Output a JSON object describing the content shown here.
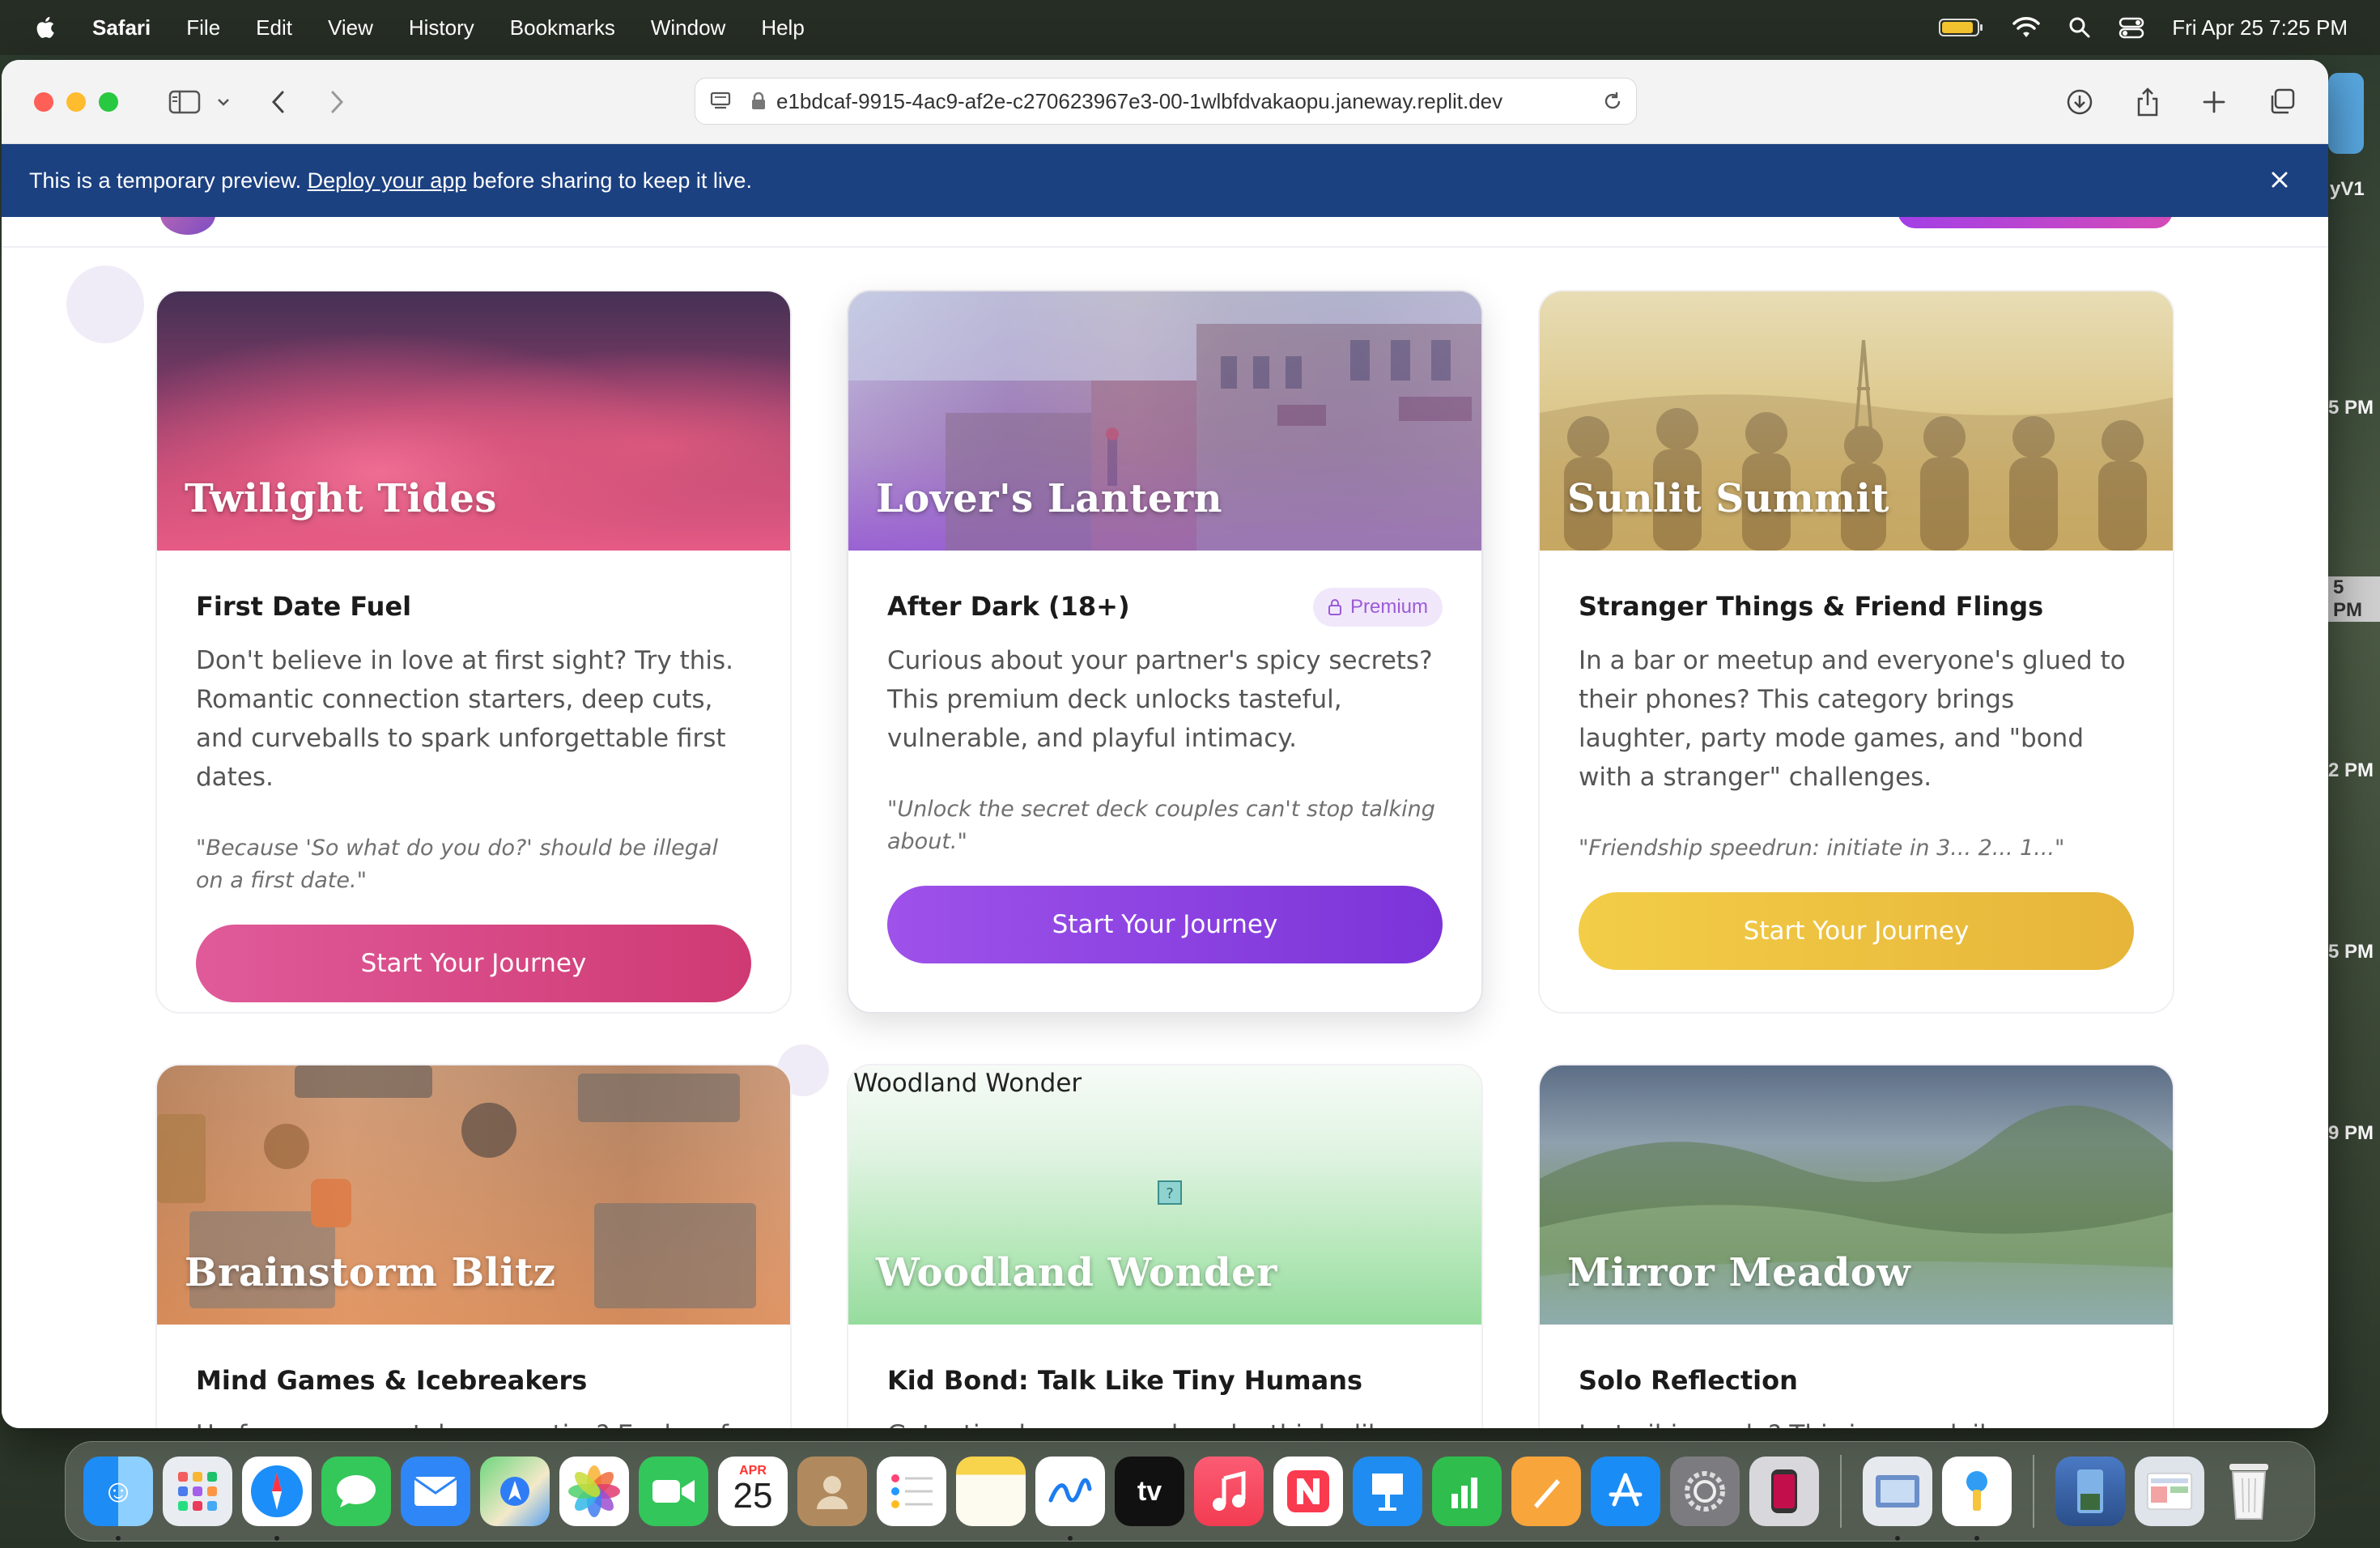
{
  "menubar": {
    "app": "Safari",
    "items": [
      "File",
      "Edit",
      "View",
      "History",
      "Bookmarks",
      "Window",
      "Help"
    ],
    "datetime": "Fri Apr 25  7:25 PM"
  },
  "browser": {
    "url": "e1bdcaf-9915-4ac9-af2e-c270623967e3-00-1wlbfdvakaopu.janeway.replit.dev"
  },
  "banner": {
    "prefix": "This is a temporary preview. ",
    "link": "Deploy your app",
    "suffix": " before sharing to keep it live."
  },
  "cards": [
    {
      "hero_title": "Twilight Tides",
      "category": "First Date Fuel",
      "description": "Don't believe in love at first sight? Try this. Romantic connection starters, deep cuts, and curveballs to spark unforgettable first dates.",
      "quote": "\"Because 'So what do you do?' should be illegal on a first date.\"",
      "button": "Start Your Journey",
      "colors": {
        "btn_from": "#e05a9a",
        "btn_to": "#cf3a73"
      }
    },
    {
      "hero_title": "Lover's Lantern",
      "category": "After Dark (18+)",
      "badge": "Premium",
      "description": "Curious about your partner's spicy secrets? This premium deck unlocks tasteful, vulnerable, and playful intimacy.",
      "quote": "\"Unlock the secret deck couples can't stop talking about.\"",
      "button": "Start Your Journey",
      "colors": {
        "btn_from": "#9e52ea",
        "btn_to": "#7b34d8"
      }
    },
    {
      "hero_title": "Sunlit Summit",
      "category": "Stranger Things & Friend Flings",
      "description": "In a bar or meetup and everyone's glued to their phones? This category brings laughter, party mode games, and \"bond with a stranger\" challenges.",
      "quote": "\"Friendship speedrun: initiate in 3... 2... 1...\"",
      "button": "Start Your Journey",
      "colors": {
        "btn_from": "#f3cd47",
        "btn_to": "#e6b53a"
      }
    },
    {
      "hero_title": "Brainstorm Blitz",
      "category": "Mind Games & Icebreakers",
      "description_peek": "Up for some mental gymnastics? Explore fun"
    },
    {
      "hero_title": "Woodland Wonder",
      "alt_text": "Woodland Wonder",
      "category": "Kid Bond: Talk Like Tiny Humans",
      "description_peek": "Got a tiny human nearby who thinks like a"
    },
    {
      "hero_title": "Mirror Meadow",
      "category": "Solo Reflection",
      "description_peek": "Just vibing solo? This is your daily"
    }
  ],
  "desktop_slivers": [
    "yV1",
    "5 PM",
    "5 PM",
    "2 PM",
    "5 PM",
    "9 PM"
  ],
  "dock": {
    "calendar_month": "APR",
    "calendar_day": "25",
    "tv_label": "tv"
  }
}
